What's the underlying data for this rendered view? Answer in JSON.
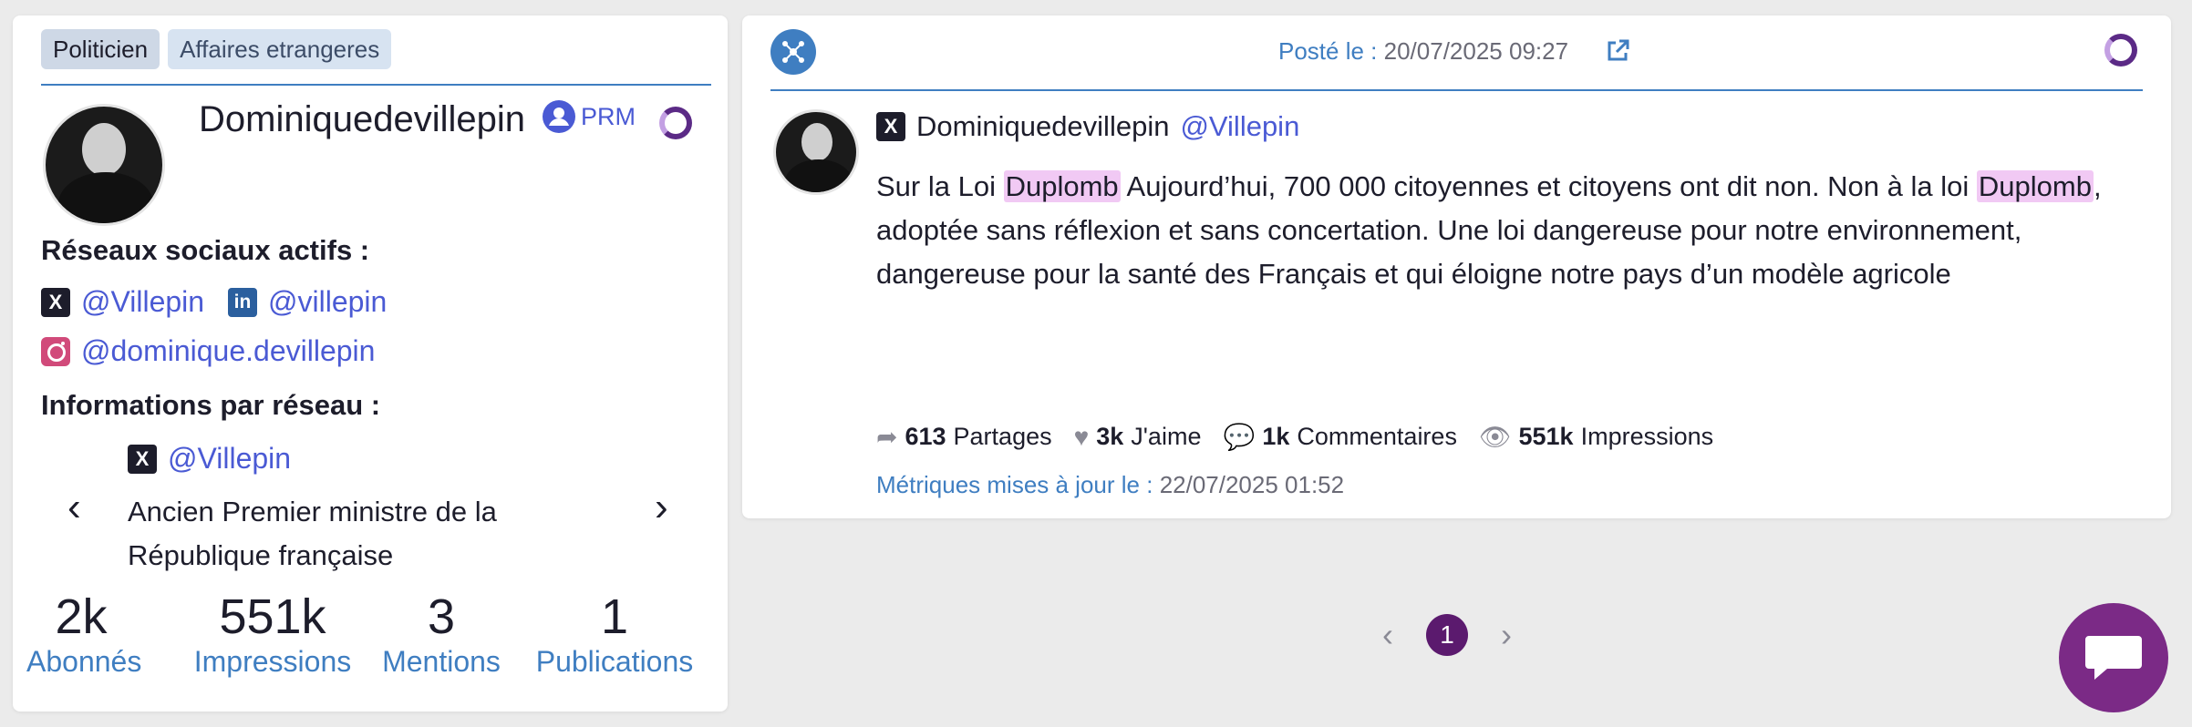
{
  "profile": {
    "tags": [
      "Politicien",
      "Affaires etrangeres"
    ],
    "name": "Dominiquedevillepin",
    "prm_label": "PRM",
    "active_networks_title": "Réseaux sociaux actifs :",
    "networks": [
      {
        "icon": "x-icon",
        "glyph": "X",
        "handle": "@Villepin"
      },
      {
        "icon": "linkedin-icon",
        "glyph": "in",
        "handle": "@villepin"
      },
      {
        "icon": "instagram-icon",
        "glyph": "",
        "handle": "@dominique.devillepin"
      }
    ],
    "info_title": "Informations par réseau :",
    "info_network_handle": "@Villepin",
    "bio": "Ancien Premier ministre de la République française",
    "prev_glyph": "‹",
    "next_glyph": "›",
    "stats": [
      {
        "value": "2k",
        "label": "Abonnés"
      },
      {
        "value": "551k",
        "label": "Impressions"
      },
      {
        "value": "3",
        "label": "Mentions"
      },
      {
        "value": "1",
        "label": "Publications"
      }
    ]
  },
  "post": {
    "posted_label": "Posté le :",
    "posted_date": "20/07/2025 09:27",
    "author_name": "Dominiquedevillepin",
    "author_handle": "@Villepin",
    "text_parts": {
      "p1": "Sur la Loi ",
      "hl1": "Duplomb",
      "p2": " Aujourd’hui, 700 000 citoyennes et citoyens ont dit non. Non à la loi ",
      "hl2": "Duplomb",
      "p3": ", adoptée sans réflexion et sans concertation. Une loi dangereuse pour notre environnement, dangereuse pour la santé des Français et qui éloigne notre pays d’un modèle agricole"
    },
    "metrics": [
      {
        "icon": "share-arrow-icon",
        "glyph": "➦",
        "value": "613",
        "label": "Partages"
      },
      {
        "icon": "heart-icon",
        "glyph": "♥",
        "value": "3k",
        "label": "J'aime"
      },
      {
        "icon": "comment-icon",
        "glyph": "💬",
        "value": "1k",
        "label": "Commentaires"
      },
      {
        "icon": "eye-icon",
        "glyph": "👁",
        "value": "551k",
        "label": "Impressions"
      }
    ],
    "updated_label": "Métriques mises à jour le :",
    "updated_date": "22/07/2025 01:52"
  },
  "pagination": {
    "prev": "‹",
    "current": "1",
    "next": "›"
  },
  "colors": {
    "accent": "#3f7ec1",
    "link": "#4a5ad4",
    "brand": "#5b1a6e",
    "highlight": "#f1c9f4"
  }
}
